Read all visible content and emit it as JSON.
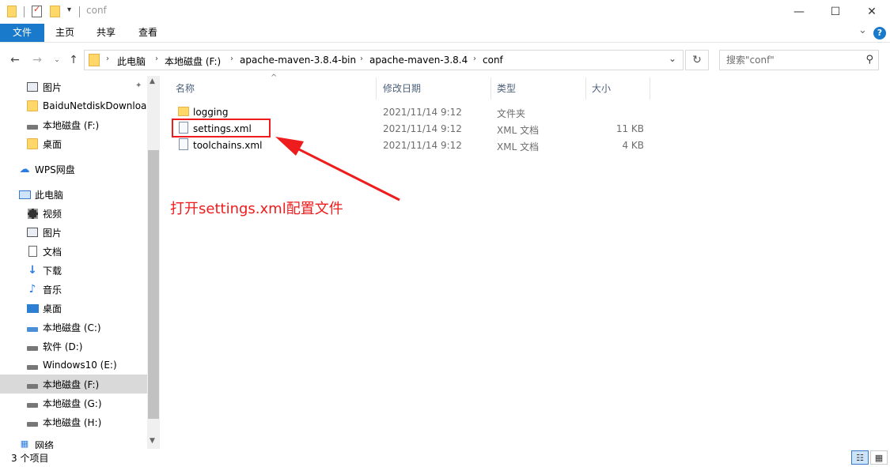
{
  "window": {
    "title": "conf",
    "minimize_glyph": "—",
    "maximize_glyph": "☐",
    "close_glyph": "✕"
  },
  "ribbon": {
    "tabs": [
      {
        "label": "文件",
        "active": true
      },
      {
        "label": "主页"
      },
      {
        "label": "共享"
      },
      {
        "label": "查看"
      }
    ],
    "expand_glyph": "⌄",
    "help_glyph": "?"
  },
  "address": {
    "crumbs": [
      "此电脑",
      "本地磁盘 (F:)",
      "apache-maven-3.8.4-bin",
      "apache-maven-3.8.4",
      "conf"
    ],
    "dropdown_glyph": "⌄",
    "refresh_glyph": "↻"
  },
  "search": {
    "placeholder": "搜索\"conf\""
  },
  "nav": {
    "items": [
      {
        "label": "图片",
        "icon": "pictures-icon",
        "pinned": true
      },
      {
        "label": "BaiduNetdiskDownload",
        "icon": "folder-icon"
      },
      {
        "label": "本地磁盘 (F:)",
        "icon": "drive-icon"
      },
      {
        "label": "桌面",
        "icon": "folder-icon"
      },
      {
        "label": "WPS网盘",
        "icon": "cloud-icon"
      },
      {
        "label": "此电脑",
        "icon": "computer-icon"
      },
      {
        "label": "视频",
        "icon": "video-icon"
      },
      {
        "label": "图片",
        "icon": "pictures-icon"
      },
      {
        "label": "文档",
        "icon": "documents-icon"
      },
      {
        "label": "下载",
        "icon": "download-icon"
      },
      {
        "label": "音乐",
        "icon": "music-icon"
      },
      {
        "label": "桌面",
        "icon": "desktop-icon"
      },
      {
        "label": "本地磁盘 (C:)",
        "icon": "system-drive-icon"
      },
      {
        "label": "软件 (D:)",
        "icon": "drive-icon"
      },
      {
        "label": "Windows10 (E:)",
        "icon": "drive-icon"
      },
      {
        "label": "本地磁盘 (F:)",
        "icon": "drive-icon",
        "selected": true
      },
      {
        "label": "本地磁盘 (G:)",
        "icon": "drive-icon"
      },
      {
        "label": "本地磁盘 (H:)",
        "icon": "drive-icon"
      },
      {
        "label": "网络",
        "icon": "network-icon"
      }
    ]
  },
  "columns": [
    "名称",
    "修改日期",
    "类型",
    "大小"
  ],
  "files": [
    {
      "name": "logging",
      "modified": "2021/11/14 9:12",
      "type": "文件夹",
      "size": "",
      "kind": "folder"
    },
    {
      "name": "settings.xml",
      "modified": "2021/11/14 9:12",
      "type": "XML 文档",
      "size": "11 KB",
      "kind": "xml"
    },
    {
      "name": "toolchains.xml",
      "modified": "2021/11/14 9:12",
      "type": "XML 文档",
      "size": "4 KB",
      "kind": "xml"
    }
  ],
  "annotation": {
    "text": "打开settings.xml配置文件",
    "color": "#ee1c1c"
  },
  "status": {
    "item_count": "3 个项目"
  },
  "colors": {
    "accent": "#1979ca",
    "selection": "#d9d9d9"
  }
}
